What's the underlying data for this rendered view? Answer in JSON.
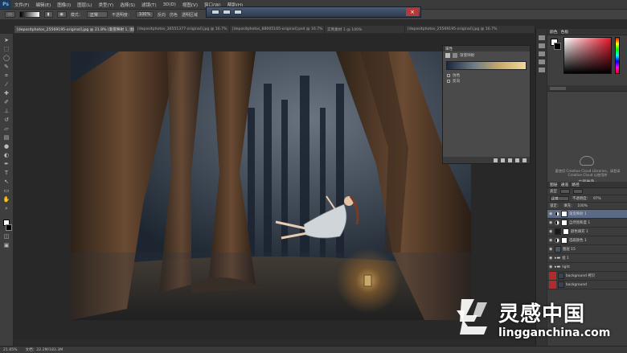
{
  "app": {
    "logo": "Ps",
    "menu": [
      "文件(F)",
      "编辑(E)",
      "图像(I)",
      "图层(L)",
      "类型(Y)",
      "选择(S)",
      "滤镜(T)",
      "3D(D)",
      "视图(V)",
      "窗口(W)",
      "帮助(H)"
    ]
  },
  "options_bar": {
    "mode_label": "模式：",
    "mode_value": "正常",
    "opacity_label": "不透明度：",
    "opacity_value": "100%",
    "reverse_label": "反向",
    "dither_label": "仿色",
    "transparency_label": "透明区域"
  },
  "tabs": [
    {
      "label": "[depositphotos_25569195-original].jpg @ 21.8% (渐变映射 1, 图层蒙版/8)",
      "active": true
    },
    {
      "label": "[depositphotos_36551377-original].jpg @ 16.7%",
      "active": false
    },
    {
      "label": "[depositphotos_88005165-original].psd @ 16.7%",
      "active": false
    },
    {
      "label": "实例素材 1 @ 100%",
      "active": false
    },
    {
      "label": "[depositphotos_25569195-original].jpg @ 16.7%",
      "active": false
    }
  ],
  "properties_panel": {
    "header": "属性",
    "title": "渐变映射",
    "options": [
      "仿色",
      "反向"
    ]
  },
  "color_panel": {
    "tabs": [
      "颜色",
      "色板"
    ]
  },
  "cc_box": {
    "message": "要使用 Creative Cloud Libraries，请登录 Creative Cloud 以使用库",
    "login": "立即登录 ›"
  },
  "layers_panel": {
    "tabs": [
      "图层",
      "通道",
      "路径"
    ],
    "kind_label": "类型",
    "blend": "正常",
    "opacity_label": "不透明度：",
    "opacity_value": "97%",
    "lock_label": "锁定：",
    "fill_label": "填充：",
    "fill_value": "100%",
    "layers": [
      {
        "name": "渐变映射 1",
        "type": "adj",
        "selected": true
      },
      {
        "name": "自然饱和度 1",
        "type": "adj",
        "selected": false
      },
      {
        "name": "颜色填充 1",
        "type": "adj",
        "selected": false
      },
      {
        "name": "选取颜色 1",
        "type": "adj",
        "selected": false
      },
      {
        "name": "图层 15",
        "type": "pixel",
        "selected": false
      },
      {
        "name": "组 1",
        "type": "group",
        "selected": false
      },
      {
        "name": "light",
        "type": "group",
        "selected": false
      },
      {
        "name": "background 拷贝",
        "type": "pixel",
        "selected": false
      },
      {
        "name": "background",
        "type": "pixel",
        "selected": false
      }
    ]
  },
  "status_bar": {
    "zoom": "21.85%",
    "doc": "文档：22.2M/183.3M"
  },
  "watermark": {
    "cn": "灵感中国",
    "en": "lingganchina.com"
  },
  "colors": {
    "accent": "#5b6a86",
    "panel": "#3f3f3f",
    "workspace": "#282828"
  }
}
